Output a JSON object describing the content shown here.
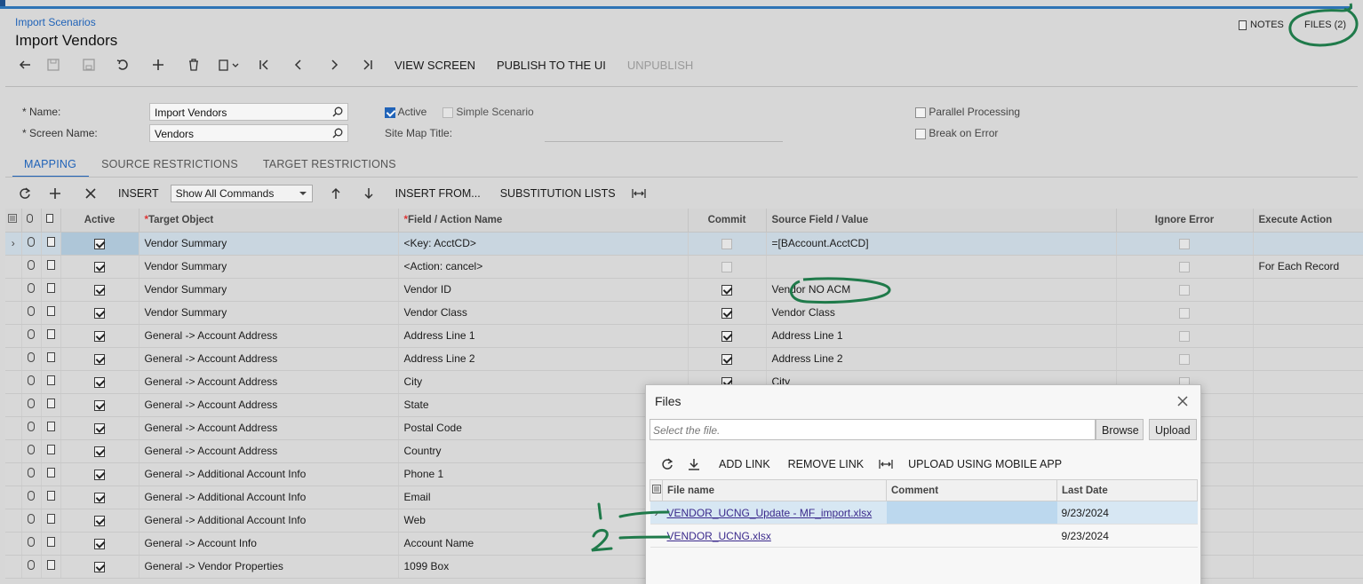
{
  "header": {
    "breadcrumb": "Import Scenarios",
    "title": "Import Vendors",
    "notes_label": "NOTES",
    "files_label": "FILES (2)"
  },
  "toolbar": {
    "view_screen": "VIEW SCREEN",
    "publish": "PUBLISH TO THE UI",
    "unpublish": "UNPUBLISH"
  },
  "form": {
    "name_label": "Name:",
    "name_value": "Import Vendors",
    "screen_label": "Screen Name:",
    "screen_value": "Vendors",
    "active_label": "Active",
    "active_checked": true,
    "simple_label": "Simple Scenario",
    "simple_checked": false,
    "sitemap_label": "Site Map Title:",
    "parallel_label": "Parallel Processing",
    "parallel_checked": false,
    "break_label": "Break on Error",
    "break_checked": false
  },
  "tabs": [
    {
      "label": "MAPPING",
      "active": true
    },
    {
      "label": "SOURCE RESTRICTIONS",
      "active": false
    },
    {
      "label": "TARGET RESTRICTIONS",
      "active": false
    }
  ],
  "grid_toolbar": {
    "insert": "INSERT",
    "filter_value": "Show All Commands",
    "insert_from": "INSERT FROM...",
    "substitution": "SUBSTITUTION LISTS"
  },
  "grid": {
    "columns": [
      "Active",
      "Target Object",
      "Field / Action Name",
      "Commit",
      "Source Field / Value",
      "Ignore Error",
      "Execute Action"
    ],
    "rows": [
      {
        "active": true,
        "target": "Vendor Summary",
        "field": "<Key: AcctCD>",
        "commit": false,
        "source": "=[BAccount.AcctCD]",
        "ignore": false,
        "exec": ""
      },
      {
        "active": true,
        "target": "Vendor Summary",
        "field": "<Action: cancel>",
        "commit": false,
        "source": "",
        "ignore": false,
        "exec": "For Each Record"
      },
      {
        "active": true,
        "target": "Vendor Summary",
        "field": "Vendor ID",
        "commit": true,
        "source": "Vendor NO ACM",
        "ignore": false,
        "exec": ""
      },
      {
        "active": true,
        "target": "Vendor Summary",
        "field": "Vendor Class",
        "commit": true,
        "source": "Vendor Class",
        "ignore": false,
        "exec": ""
      },
      {
        "active": true,
        "target": "General -> Account Address",
        "field": "Address Line 1",
        "commit": true,
        "source": "Address Line 1",
        "ignore": false,
        "exec": ""
      },
      {
        "active": true,
        "target": "General -> Account Address",
        "field": "Address Line 2",
        "commit": true,
        "source": "Address Line 2",
        "ignore": false,
        "exec": ""
      },
      {
        "active": true,
        "target": "General -> Account Address",
        "field": "City",
        "commit": true,
        "source": "City",
        "ignore": false,
        "exec": ""
      },
      {
        "active": true,
        "target": "General -> Account Address",
        "field": "State",
        "commit": true,
        "source": "",
        "ignore": false,
        "exec": ""
      },
      {
        "active": true,
        "target": "General -> Account Address",
        "field": "Postal Code",
        "commit": true,
        "source": "",
        "ignore": false,
        "exec": ""
      },
      {
        "active": true,
        "target": "General -> Account Address",
        "field": "Country",
        "commit": true,
        "source": "",
        "ignore": false,
        "exec": ""
      },
      {
        "active": true,
        "target": "General -> Additional Account Info",
        "field": "Phone 1",
        "commit": true,
        "source": "",
        "ignore": false,
        "exec": ""
      },
      {
        "active": true,
        "target": "General -> Additional Account Info",
        "field": "Email",
        "commit": true,
        "source": "",
        "ignore": false,
        "exec": ""
      },
      {
        "active": true,
        "target": "General -> Additional Account Info",
        "field": "Web",
        "commit": true,
        "source": "",
        "ignore": false,
        "exec": ""
      },
      {
        "active": true,
        "target": "General -> Account Info",
        "field": "Account Name",
        "commit": true,
        "source": "",
        "ignore": false,
        "exec": ""
      },
      {
        "active": true,
        "target": "General -> Vendor Properties",
        "field": "1099 Box",
        "commit": true,
        "source": "",
        "ignore": false,
        "exec": ""
      }
    ]
  },
  "files_dialog": {
    "title": "Files",
    "input_placeholder": "Select the file.",
    "browse_label": "Browse",
    "upload_label": "Upload",
    "add_link": "ADD LINK",
    "remove_link": "REMOVE LINK",
    "upload_mobile": "UPLOAD USING MOBILE APP",
    "columns": [
      "File name",
      "Comment",
      "Last Date"
    ],
    "files": [
      {
        "name": "VENDOR_UCNG_Update - MF_import.xlsx",
        "comment": "",
        "date": "9/23/2024"
      },
      {
        "name": "VENDOR_UCNG.xlsx",
        "comment": "",
        "date": "9/23/2024"
      }
    ]
  },
  "annotations": {
    "marker_1": "1",
    "marker_2": "2",
    "ink_color": "#1f7a4a"
  },
  "colors": {
    "accent": "#2063b8",
    "selected_row": "#c9d6e0"
  }
}
